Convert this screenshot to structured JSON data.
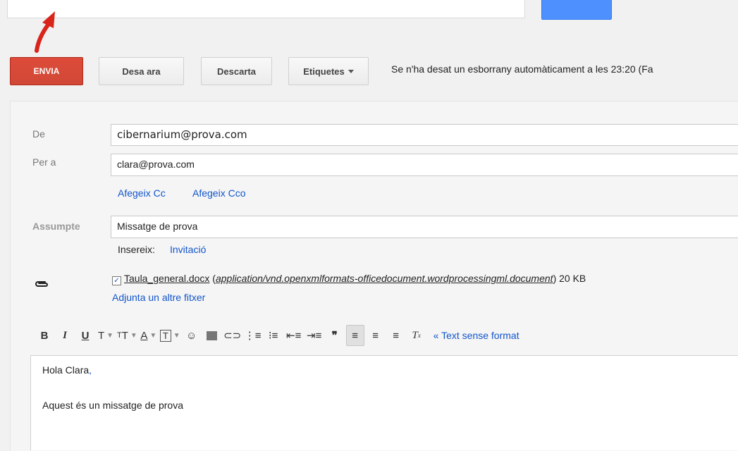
{
  "toolbar": {
    "send_label": "ENVIA",
    "save_label": "Desa ara",
    "discard_label": "Descarta",
    "labels_label": "Etiquetes",
    "autosave_status": "Se n'ha desat un esborrany automàticament a les 23:20 (Fa"
  },
  "form": {
    "from_label": "De",
    "from_value": "cibernarium@prova.com",
    "to_label": "Per a",
    "to_value": "clara@prova.com",
    "add_cc": "Afegeix Cc",
    "add_bcc": "Afegeix Cco",
    "subject_label": "Assumpte",
    "subject_value": "Missatge de prova",
    "insert_label": "Insereix:",
    "insert_link": "Invitació"
  },
  "attachment": {
    "filename": "Taula_general.docx",
    "open_paren": " (",
    "mimetype": "application/vnd.openxmlformats-officedocument.wordprocessingml.document",
    "size": ") 20 KB",
    "add_another": "Adjunta un altre fitxer"
  },
  "format_toolbar": {
    "plain_text_link": "« Text sense format"
  },
  "body": {
    "greeting": "Hola Clara",
    "greeting_comma": ",",
    "line": "Aquest és un missatge de prova"
  },
  "colors": {
    "send_button": "#d14836",
    "link": "#1155cc",
    "search_button": "#4d90fe",
    "arrow": "#d9241b"
  }
}
